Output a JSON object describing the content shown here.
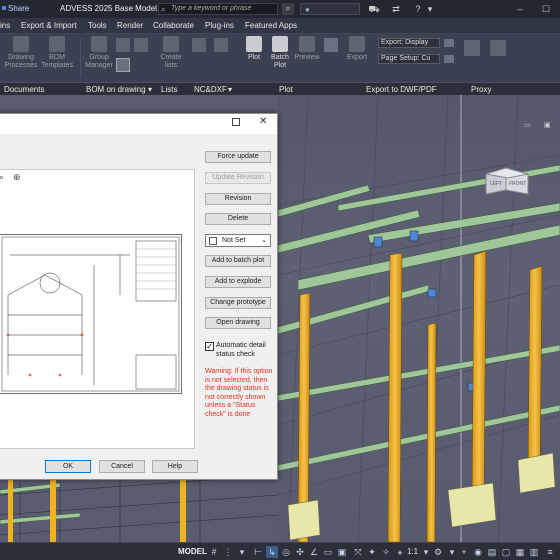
{
  "titlebar": {
    "share": "Share",
    "title": "ADVESS 2025 Base Model.dwg",
    "search_placeholder": "Type a keyword or phrase",
    "icons": [
      "search-icon",
      "user-icon",
      "cart-icon",
      "exchange-icon",
      "help-icon",
      "minimize-icon",
      "maximize-icon"
    ]
  },
  "menubar": {
    "items": [
      "ins",
      "Export & Import",
      "Tools",
      "Render",
      "Collaborate",
      "Plug-ins",
      "Featured Apps"
    ]
  },
  "ribbon": {
    "buttons": {
      "drawing_processes": "Drawing\nProcesses",
      "bom_templates": "BOM\nTemplates",
      "group_manager": "Group\nManager",
      "create_lists": "Create\nlists",
      "plot": "Plot",
      "batch_plot": "Batch\nPlot",
      "preview": "Preview",
      "export": "Export"
    },
    "export_label": "Export: Display",
    "page_setup_label": "Page Setup: Cu"
  },
  "ribbonbar": {
    "documents": "Documents",
    "bom_on_drawing": "BOM on drawing",
    "lists": "Lists",
    "ncdxf": "NC&DXF",
    "plot": "Plot",
    "export_dwf": "Export to DWF/PDF",
    "proxy": "Proxy"
  },
  "dialog": {
    "buttons": {
      "force_update": "Force update",
      "update_revision": "Update Revision",
      "revision": "Revision",
      "delete": "Delete",
      "add_batch_plot": "Add to batch plot",
      "add_explode": "Add to explode",
      "change_prototype": "Change prototype",
      "open_drawing": "Open drawing",
      "ok": "OK",
      "cancel": "Cancel",
      "help": "Help"
    },
    "status_select": "Not Set",
    "auto_check_label": "Automatic detail status check",
    "auto_check_checked": true,
    "warning": "Warning: If this option is not selected, then the drawing status is not correctly shown unless a \"Status check\" is done"
  },
  "viewcube": {
    "left": "LEFT",
    "front": "FRONT"
  },
  "statusbar": {
    "model": "MODEL",
    "scale": "1:1"
  },
  "colors": {
    "accent": "#0078d7",
    "warning": "#e0301e",
    "column": "#f0b21f",
    "beam": "#9fc79a"
  }
}
